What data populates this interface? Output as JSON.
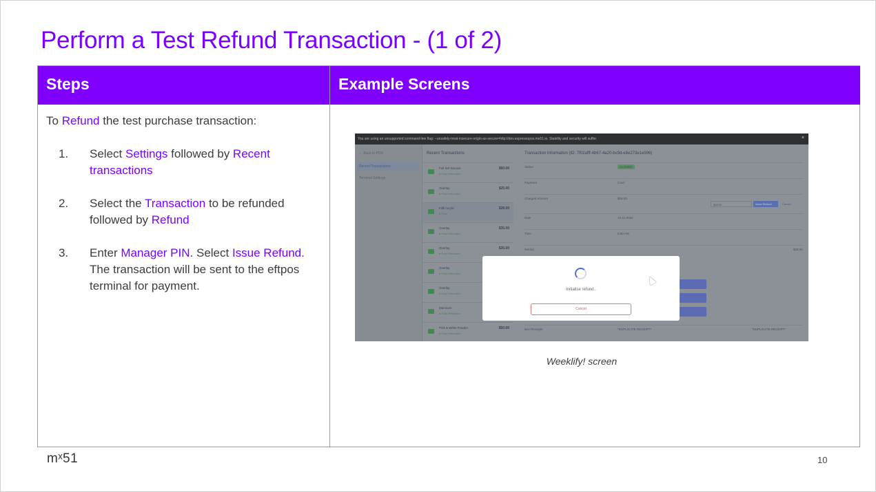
{
  "slide": {
    "title": "Perform a Test Refund Transaction - (1 of 2)",
    "logo": "mˣ51",
    "page_number": "10"
  },
  "table": {
    "col1_header": "Steps",
    "col2_header": "Example Screens"
  },
  "steps": {
    "intro_prefix": "To ",
    "intro_highlight": "Refund",
    "intro_suffix": " the test purchase transaction:",
    "items": [
      {
        "num": "1.",
        "parts": [
          {
            "t": "Select ",
            "h": false
          },
          {
            "t": "Settings",
            "h": true
          },
          {
            "t": " followed by ",
            "h": false
          },
          {
            "t": "Recent transactions",
            "h": true
          }
        ]
      },
      {
        "num": "2.",
        "parts": [
          {
            "t": "Select the ",
            "h": false
          },
          {
            "t": "Transaction",
            "h": true
          },
          {
            "t": " to be refunded followed by ",
            "h": false
          },
          {
            "t": "Refund",
            "h": true
          }
        ]
      },
      {
        "num": "3.",
        "parts": [
          {
            "t": "Enter ",
            "h": false
          },
          {
            "t": "Manager PIN",
            "h": true
          },
          {
            "t": ". Select ",
            "h": false
          },
          {
            "t": "Issue Refund.",
            "h": true
          },
          {
            "t": " The transaction will be sent to the eftpos terminal for payment.",
            "h": false
          }
        ]
      }
    ]
  },
  "screenshot": {
    "warning_bar": "You are using an unsupported command-line flag: --unsafely-treat-insecure-origin-as-secure=http://dev.espressopos.me51.io. Stability and security will suffer.",
    "close": "×",
    "back": "← Back to POS",
    "sidebar_items": [
      "Recent Transactions",
      "Terminal Settings"
    ],
    "list_title": "Recent Transactions",
    "transactions": [
      {
        "name": "Full Set Service",
        "status": "● Fully Refunded",
        "amount": "$60.00"
      },
      {
        "name": "Overlay",
        "status": "● Fully Refunded",
        "amount": "$25.00"
      },
      {
        "name": "Infill Acrylic",
        "status": "● Paid",
        "amount": "$28.00"
      },
      {
        "name": "Overlay",
        "status": "● Fully Refunded",
        "amount": "$35.00"
      },
      {
        "name": "Overlay",
        "status": "● Fully Refunded",
        "amount": "$35.00"
      },
      {
        "name": "Overlay",
        "status": "● Fully Refunded",
        "amount": ""
      },
      {
        "name": "Overlay",
        "status": "● Fully Refunded",
        "amount": ""
      },
      {
        "name": "Manicure",
        "status": "● Fully Refunded",
        "amount": ""
      },
      {
        "name": "Pink & White Powder",
        "status": "● Fully Refunded",
        "amount": "$50.00"
      }
    ],
    "detail_title": "Transaction Information (ID: 7f02afff-4b67-4a20-bc9d-e8e273e1e596)",
    "detail_rows": [
      {
        "label": "Status",
        "value": "CLOSED"
      },
      {
        "label": "Payment",
        "value": "Card"
      },
      {
        "label": "Charged Amount",
        "value": "$28.00"
      },
      {
        "label": "Date",
        "value": "10-11-2022"
      },
      {
        "label": "Time",
        "value": "8:50 AM"
      },
      {
        "label": "Item(s)",
        "value": ""
      }
    ],
    "refund_field": "$28.00",
    "issue_refund_btn": "Issue Refund",
    "cancel_link": "Cancel",
    "item_amount": "$28.00",
    "receipts_label": "Box Receipts",
    "receipt_a": "*DUPLICATE RECEIPT*",
    "receipt_b": "*DUPLICATE RECEIPT*",
    "modal_text": "Initialise refund..",
    "modal_cancel": "Cancel"
  },
  "caption": "Weeklify! screen"
}
